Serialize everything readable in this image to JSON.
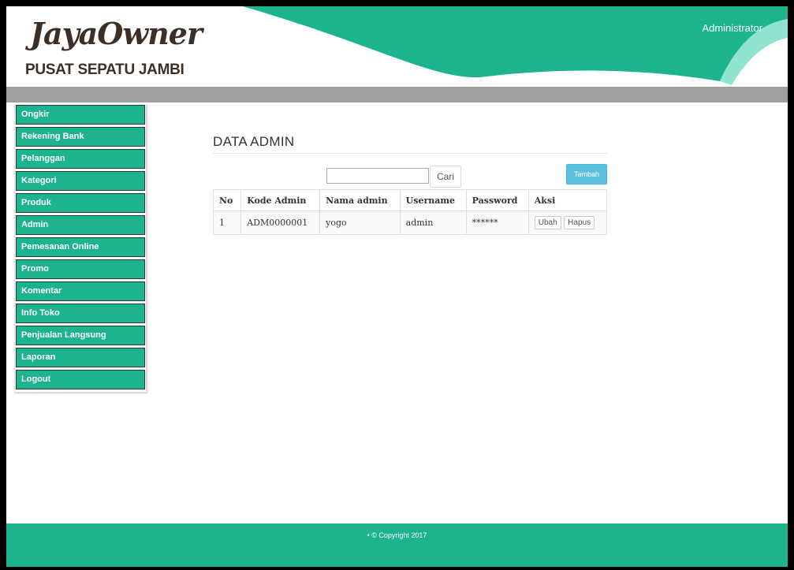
{
  "header": {
    "logo_script": "JayaOwner",
    "logo_subtitle": "PUSAT SEPATU JAMBI",
    "user_label": "Administrator"
  },
  "colors": {
    "brand": "#1cb48e",
    "gray_bar": "#a0a0a0",
    "info_button": "#5bc0de",
    "logo_text": "#3d2e26"
  },
  "sidebar": {
    "items": [
      {
        "label": "Ongkir"
      },
      {
        "label": "Rekening Bank"
      },
      {
        "label": "Pelanggan"
      },
      {
        "label": "Kategori"
      },
      {
        "label": "Produk"
      },
      {
        "label": "Admin"
      },
      {
        "label": "Pemesanan Online"
      },
      {
        "label": "Promo"
      },
      {
        "label": "Komentar"
      },
      {
        "label": "Info Toko"
      },
      {
        "label": "Penjualan Langsung"
      },
      {
        "label": "Laporan"
      },
      {
        "label": "Logout"
      }
    ]
  },
  "main": {
    "title": "DATA ADMIN",
    "search": {
      "value": "",
      "button_label": "Cari"
    },
    "add_button_label": "Tambah",
    "table": {
      "headers": [
        "No",
        "Kode Admin",
        "Nama admin",
        "Username",
        "Password",
        "Aksi"
      ],
      "rows": [
        {
          "no": "1",
          "kode": "ADM0000001",
          "nama": "yogo",
          "username": "admin",
          "password": "******",
          "edit_label": "Ubah",
          "delete_label": "Hapus"
        }
      ]
    }
  },
  "footer": {
    "text": "• © Copyright 2017"
  }
}
